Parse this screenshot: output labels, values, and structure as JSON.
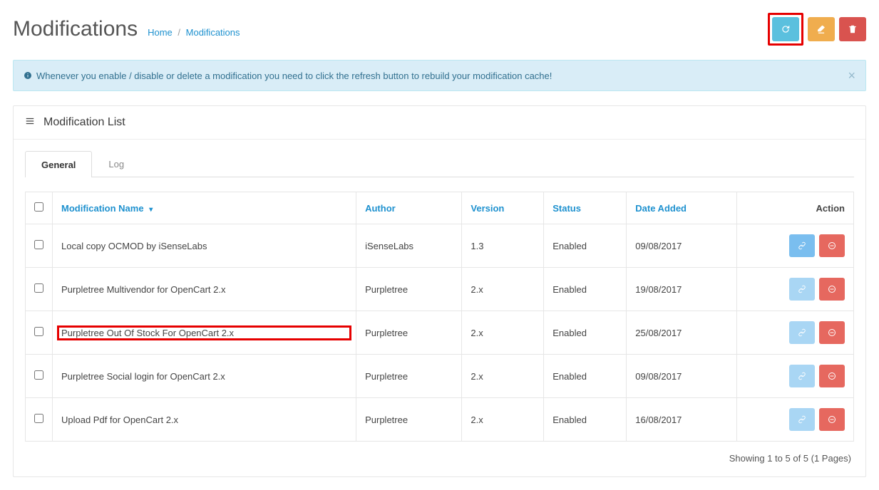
{
  "header": {
    "title": "Modifications",
    "breadcrumb_home": "Home",
    "breadcrumb_current": "Modifications"
  },
  "alert": {
    "text": "Whenever you enable / disable or delete a modification you need to click the refresh button to rebuild your modification cache!"
  },
  "panel": {
    "title": "Modification List"
  },
  "tabs": {
    "general": "General",
    "log": "Log"
  },
  "columns": {
    "name": "Modification Name",
    "author": "Author",
    "version": "Version",
    "status": "Status",
    "date": "Date Added",
    "action": "Action"
  },
  "rows": [
    {
      "name": "Local copy OCMOD by iSenseLabs",
      "author": "iSenseLabs",
      "version": "1.3",
      "status": "Enabled",
      "date": "09/08/2017",
      "dim": false,
      "highlight": false
    },
    {
      "name": "Purpletree Multivendor for OpenCart 2.x",
      "author": "Purpletree",
      "version": "2.x",
      "status": "Enabled",
      "date": "19/08/2017",
      "dim": true,
      "highlight": false
    },
    {
      "name": "Purpletree Out Of Stock For OpenCart 2.x",
      "author": "Purpletree",
      "version": "2.x",
      "status": "Enabled",
      "date": "25/08/2017",
      "dim": true,
      "highlight": true
    },
    {
      "name": "Purpletree Social login for OpenCart 2.x",
      "author": "Purpletree",
      "version": "2.x",
      "status": "Enabled",
      "date": "09/08/2017",
      "dim": true,
      "highlight": false
    },
    {
      "name": "Upload Pdf for OpenCart 2.x",
      "author": "Purpletree",
      "version": "2.x",
      "status": "Enabled",
      "date": "16/08/2017",
      "dim": true,
      "highlight": false
    }
  ],
  "pagination": "Showing 1 to 5 of 5 (1 Pages)"
}
